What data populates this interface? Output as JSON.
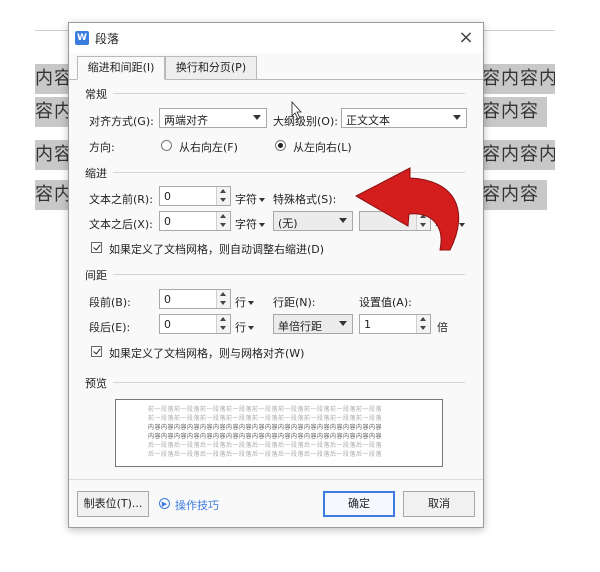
{
  "document": {
    "left_lines": [
      "内容",
      "容内容",
      "内容",
      "容内容"
    ],
    "right_lines": [
      "容内容内",
      "容内容",
      "容内容内",
      "容内容"
    ]
  },
  "dialog": {
    "app_icon": "W",
    "title": "段落",
    "close": "×",
    "tabs": [
      {
        "label": "缩进和间距(I)",
        "active": true
      },
      {
        "label": "换行和分页(P)",
        "active": false
      }
    ],
    "general": {
      "section": "常规",
      "alignment_label": "对齐方式(G):",
      "alignment_value": "两端对齐",
      "outline_label": "大纲级别(O):",
      "outline_value": "正文文本",
      "direction_label": "方向:",
      "rtl_label": "从右向左(F)",
      "ltr_label": "从左向右(L)"
    },
    "indent": {
      "section": "缩进",
      "before_label": "文本之前(R):",
      "before_value": "0",
      "after_label": "文本之后(X):",
      "after_value": "0",
      "unit": "字符",
      "special_label": "特殊格式(S):",
      "special_value": "(无)",
      "measure_value": "",
      "auto_adjust": "如果定义了文档网格，则自动调整右缩进(D)"
    },
    "spacing": {
      "section": "间距",
      "before_label": "段前(B):",
      "before_value": "0",
      "after_label": "段后(E):",
      "after_value": "0",
      "unit": "行",
      "line_label": "行距(N):",
      "line_value": "单倍行距",
      "set_label": "设置值(A):",
      "set_value": "1",
      "set_unit": "倍",
      "snap_grid": "如果定义了文档网格，则与网格对齐(W)"
    },
    "preview": {
      "section": "预览",
      "lines": [
        "前一段落前一段落前一段落前一段落前一段落前一段落前一段落前一段落前一段落",
        "前一段落前一段落前一段落前一段落前一段落前一段落前一段落前一段落前一段落",
        "内容内容内容内容内容内容内容内容内容内容内容内容内容内容内容内容内容内容",
        "内容内容内容内容内容内容内容内容内容内容内容内容内容内容内容内容内容内容",
        "后一段落后一段落后一段落后一段落后一段落后一段落后一段落后一段落后一段落",
        "后一段落后一段落后一段落后一段落后一段落后一段落后一段落后一段落后一段落"
      ]
    },
    "buttons": {
      "tabs": "制表位(T)...",
      "tips": "操作技巧",
      "ok": "确定",
      "cancel": "取消"
    }
  },
  "colors": {
    "arrow_red": "#d41e1e",
    "accent_blue": "#3d7be0"
  }
}
